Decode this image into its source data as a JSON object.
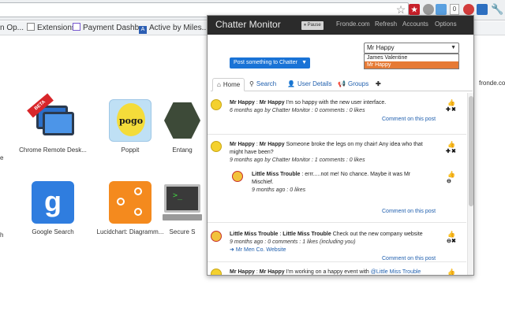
{
  "browser": {
    "bookmarks": [
      {
        "label": "n Op..."
      },
      {
        "label": "Extensions"
      },
      {
        "label": "Payment Dashb..."
      },
      {
        "label": "Active by Miles..."
      }
    ],
    "ext_count": "0",
    "ext_badge": "★"
  },
  "newtab": {
    "partial_link": "fronde.com",
    "left_cut_1": "e",
    "left_cut_2": "h",
    "apps": [
      {
        "label": "Chrome Remote Desk...",
        "icon": "chrome-remote-desktop-icon",
        "ribbon": "BETA"
      },
      {
        "label": "Poppit",
        "icon": "poppit-icon",
        "word": "pogo"
      },
      {
        "label": "Entang",
        "icon": "entanglement-icon"
      },
      {
        "label": "Google Search",
        "icon": "google-search-icon",
        "glyph": "g"
      },
      {
        "label": "Lucidchart: Diagramm...",
        "icon": "lucidchart-icon"
      },
      {
        "label": "Secure S",
        "icon": "secure-shell-icon",
        "prompt": ">_"
      }
    ]
  },
  "popup": {
    "title": "Chatter Monitor",
    "pause_label": "Pause",
    "nav": [
      "Fronde.com",
      "Refresh",
      "Accounts",
      "Options"
    ],
    "user_select": {
      "value": "Mr Happy",
      "options": [
        "James Valentine",
        "Mr Happy"
      ]
    },
    "post_button": "Post something to Chatter",
    "tabs": [
      {
        "label": "Home",
        "icon": "home-icon"
      },
      {
        "label": "Search",
        "icon": "search-icon"
      },
      {
        "label": "User Details",
        "icon": "user-icon"
      },
      {
        "label": "Groups",
        "icon": "megaphone-icon"
      }
    ],
    "feed": [
      {
        "author": "Mr Happy",
        "sep": " : ",
        "target": "Mr Happy",
        "body": " I'm so happy with the new user interface.",
        "meta": "6 months ago by Chatter Monitor : 0 comments : 0 likes",
        "comment_link": "Comment on this post"
      },
      {
        "author": "Mr Happy",
        "sep": " : ",
        "target": "Mr Happy",
        "body_line1": " Someone broke the legs on my chair! Any idea who that",
        "body_line2": "might have been?",
        "meta": "9 months ago by Chatter Monitor : 1 comments : 0 likes",
        "comment": {
          "author": "Little Miss Trouble",
          "body_line1": " : errr.....not me! No chance. Maybe it was Mr",
          "body_line2": "Mischief.",
          "meta": "9 months ago : 0 likes"
        },
        "comment_link": "Comment on this post"
      },
      {
        "author": "Little Miss Trouble",
        "sep": " : ",
        "target": "Little Miss Trouble",
        "body": " Check out the new company website",
        "meta": "9 months ago : 0 comments : 1 likes (including you)",
        "link": "Mr Men Co. Website",
        "comment_link": "Comment on this post"
      },
      {
        "author": "Mr Happy",
        "sep": " : ",
        "target": "Mr Happy",
        "body": " I'm working on a happy event with ",
        "mention": "@Little Miss Trouble"
      }
    ]
  }
}
